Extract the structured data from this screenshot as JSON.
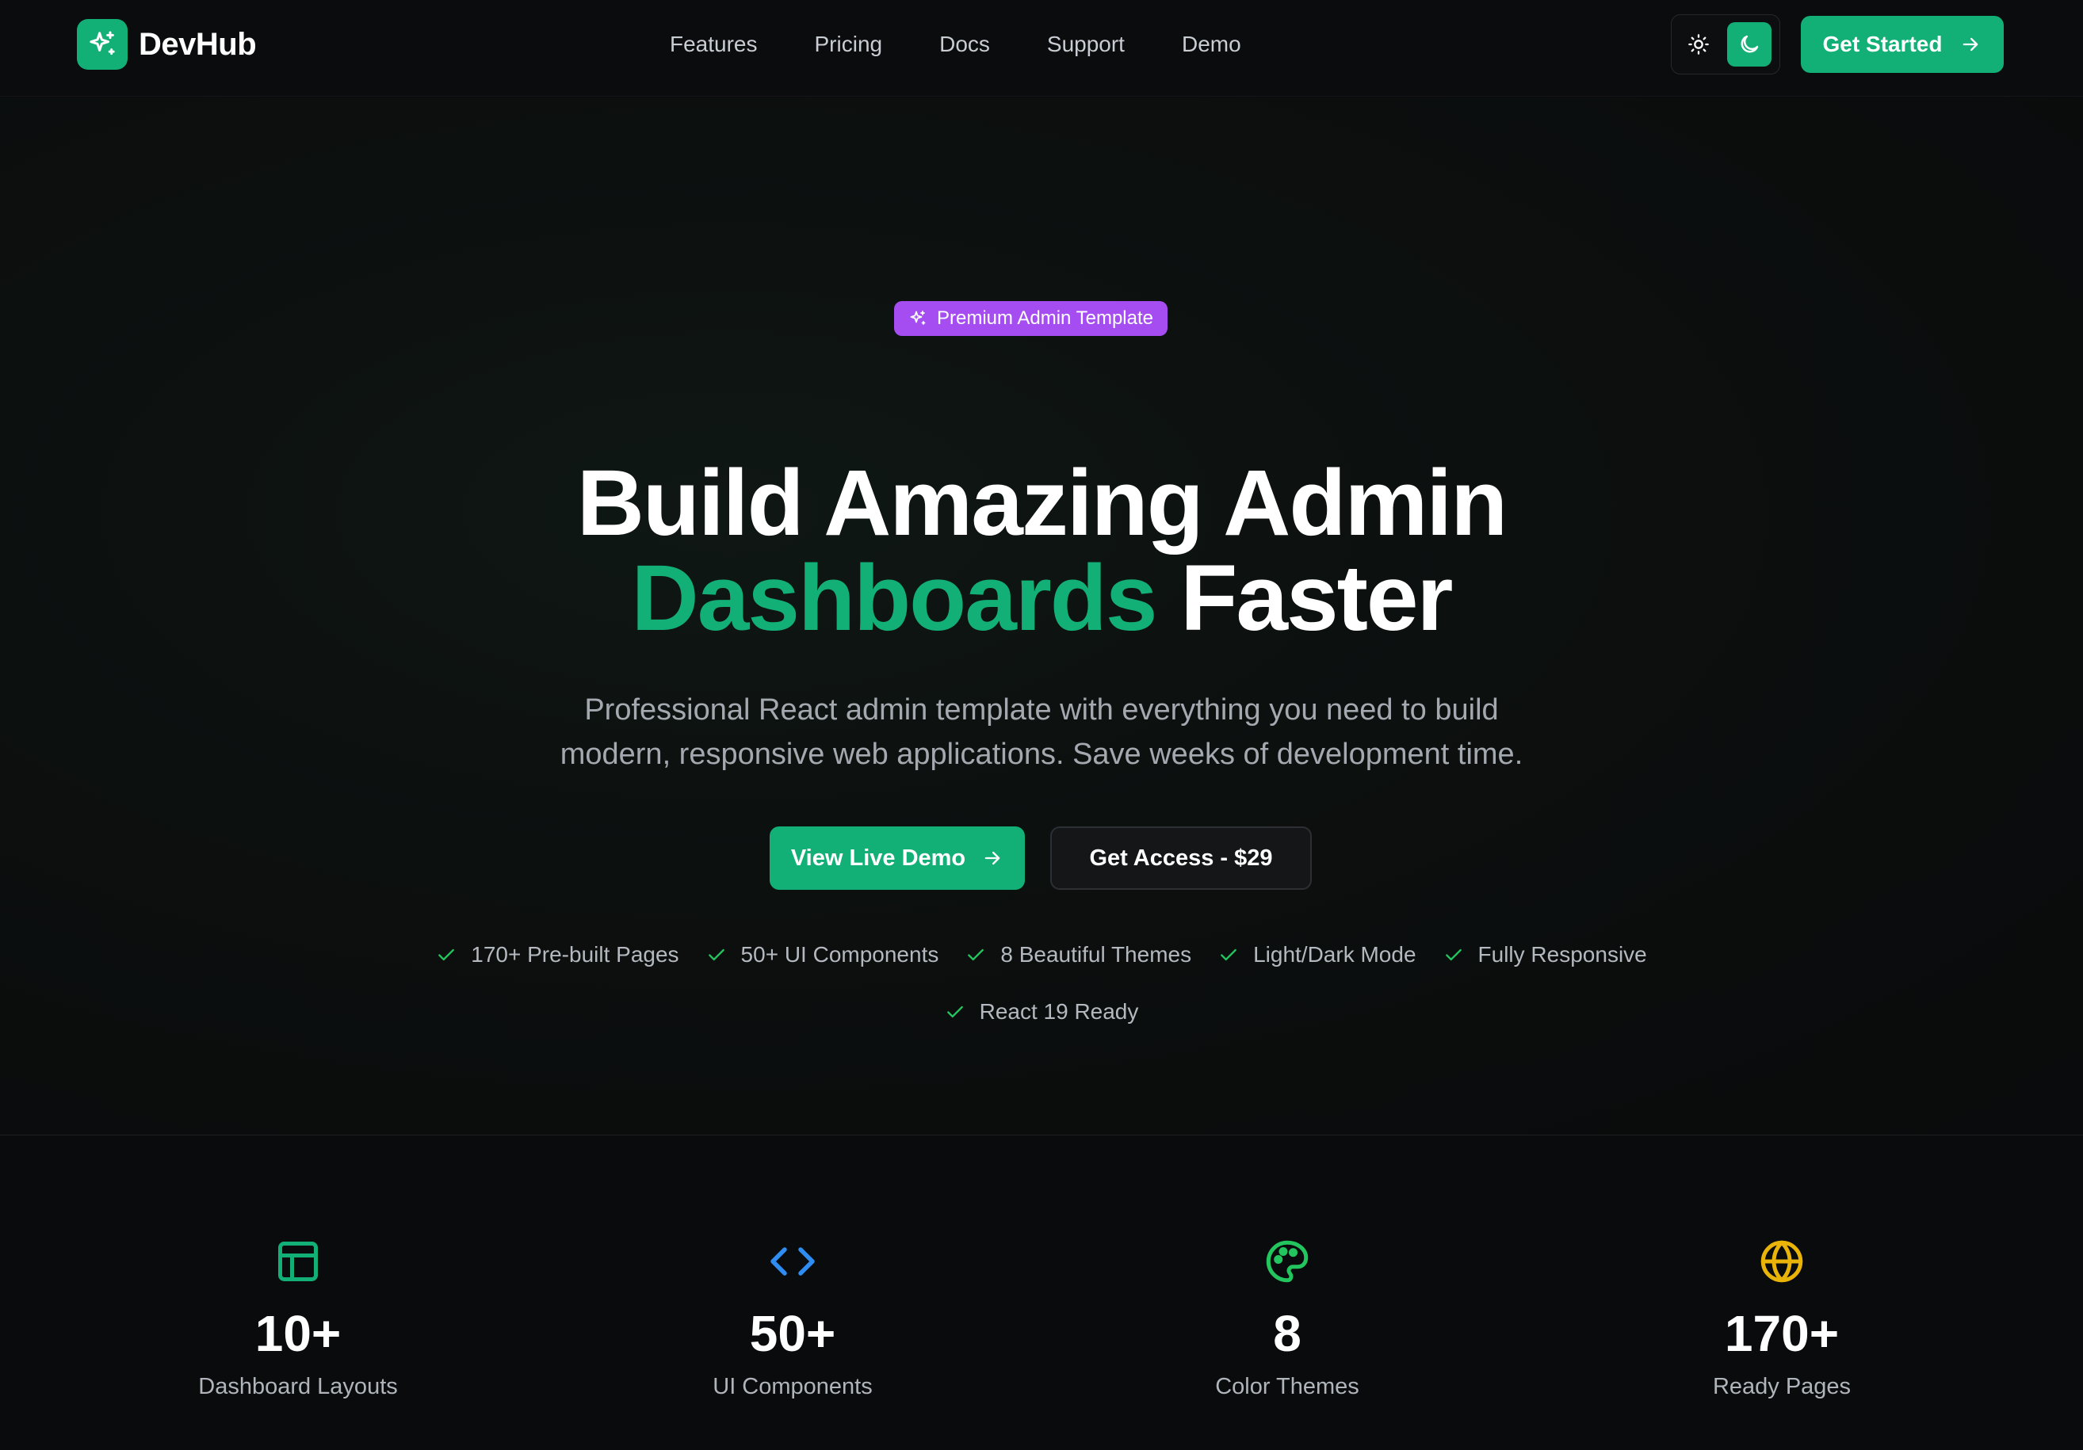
{
  "brand": {
    "name": "DevHub",
    "logo_icon": "sparkles-icon",
    "color": "#12b076"
  },
  "nav": {
    "links": [
      "Features",
      "Pricing",
      "Docs",
      "Support",
      "Demo"
    ],
    "cta_label": "Get Started",
    "theme_toggle": {
      "options": [
        "sun-icon",
        "moon-icon"
      ],
      "active": "moon-icon"
    }
  },
  "hero": {
    "badge": "Premium Admin Template",
    "title_line1": "Build Amazing Admin",
    "title_highlight": "Dashboards",
    "title_rest": "Faster",
    "subtitle_line1": "Professional React admin template with everything you need to build",
    "subtitle_line2": "modern, responsive web applications. Save weeks of development time.",
    "primary_button": "View Live Demo",
    "secondary_button": "Get Access - $29",
    "features": [
      "170+ Pre-built Pages",
      "50+ UI Components",
      "8 Beautiful Themes",
      "Light/Dark Mode",
      "Fully Responsive",
      "React 19 Ready"
    ]
  },
  "stats": [
    {
      "icon": "layout-icon",
      "color": "#12b076",
      "value": "10+",
      "label": "Dashboard Layouts"
    },
    {
      "icon": "code-icon",
      "color": "#2f8cf0",
      "value": "50+",
      "label": "UI Components"
    },
    {
      "icon": "palette-icon",
      "color": "#22c55e",
      "value": "8",
      "label": "Color Themes"
    },
    {
      "icon": "globe-icon",
      "color": "#eab308",
      "value": "170+",
      "label": "Ready Pages"
    }
  ],
  "colors": {
    "accent": "#12b076",
    "badge": "#a64df2",
    "check": "#22c55e"
  }
}
